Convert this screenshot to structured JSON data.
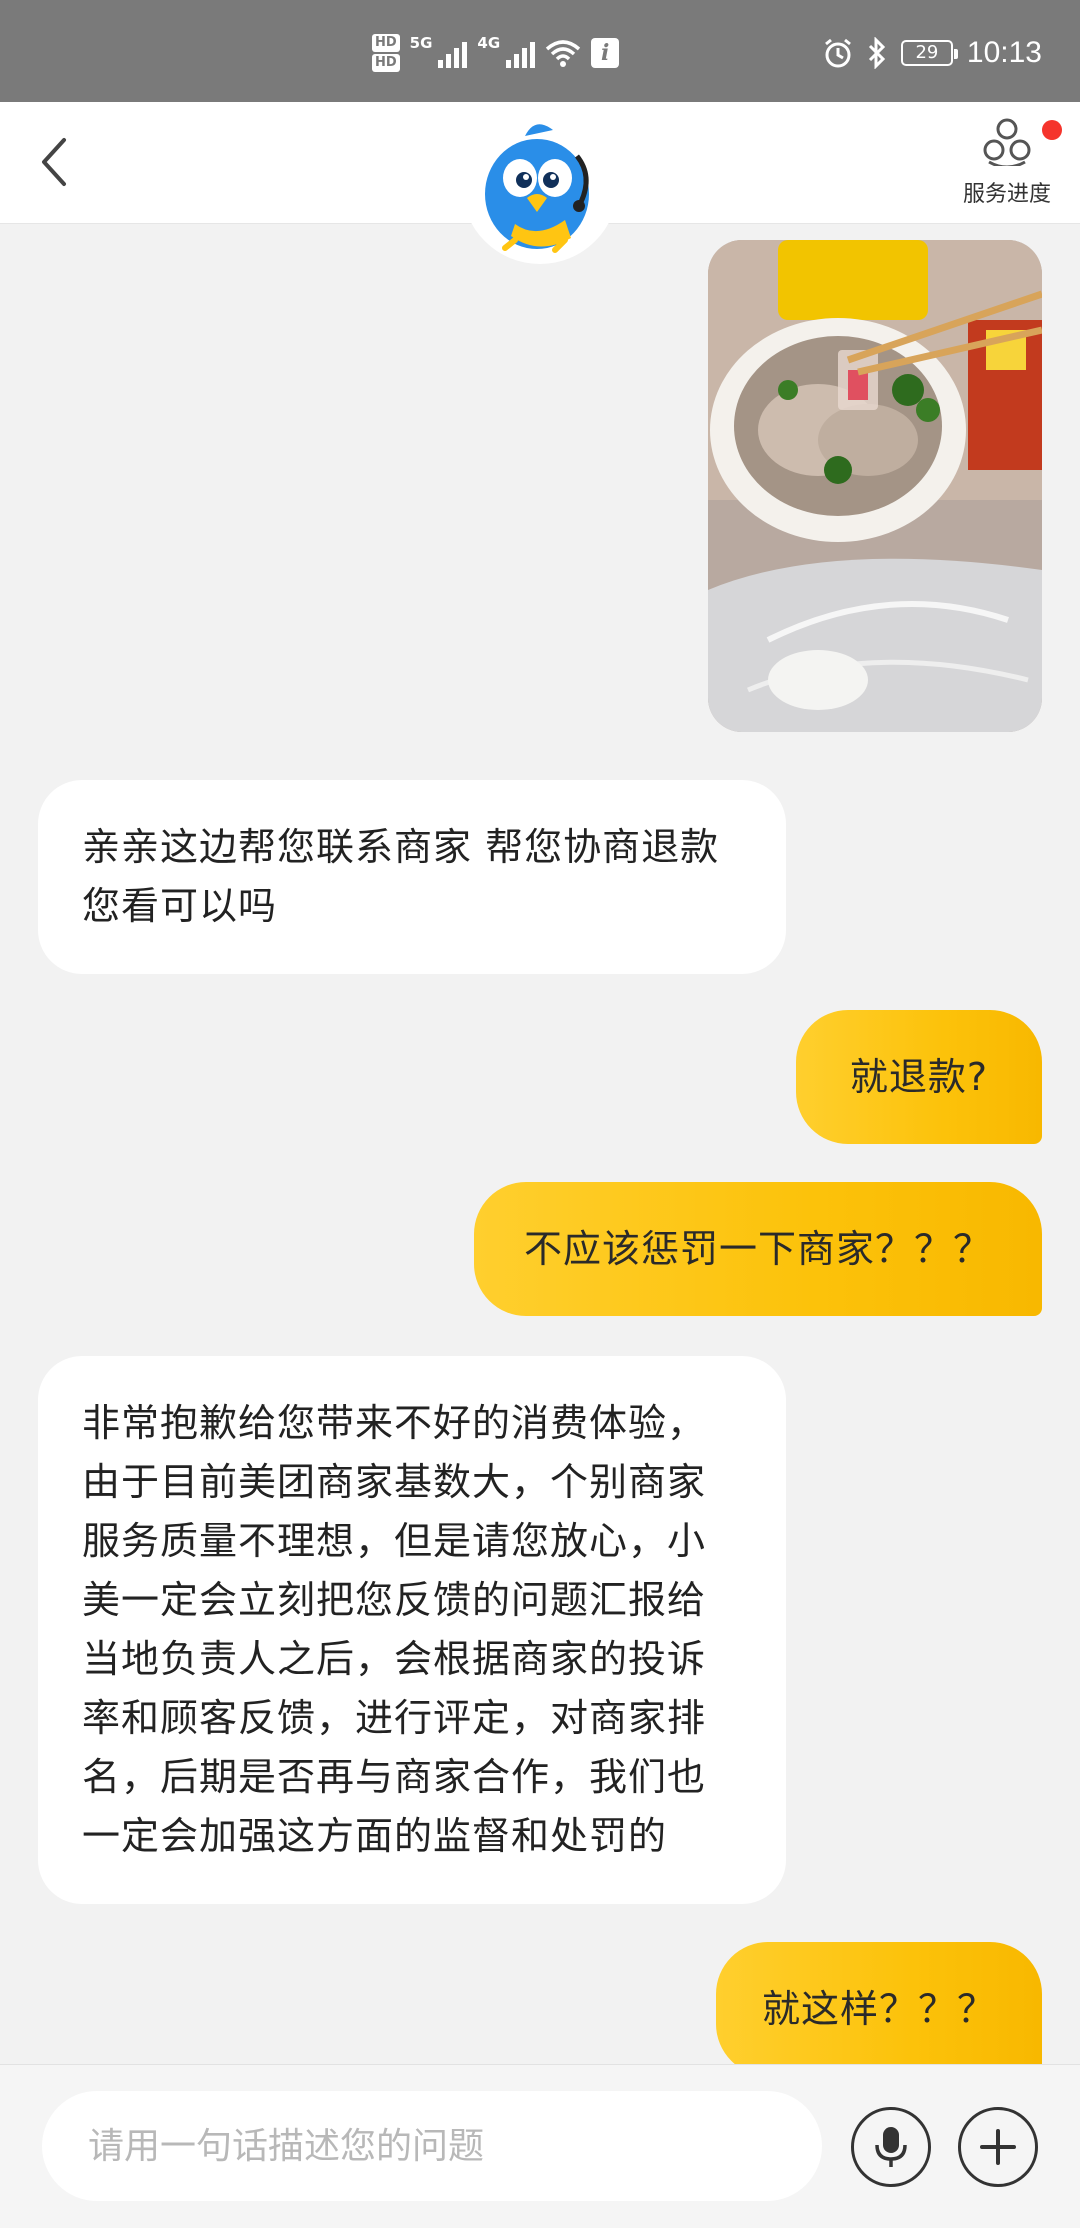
{
  "status_bar": {
    "hd1": "HD",
    "hd2": "HD",
    "net1": "5G",
    "net2": "4G",
    "battery": "29",
    "time": "10:13"
  },
  "header": {
    "service_label": "服务进度"
  },
  "messages": [
    {
      "side": "out",
      "type": "image",
      "icon": "food-photo"
    },
    {
      "side": "in",
      "text": "亲亲这边帮您联系商家  帮您协商退款您看可以吗"
    },
    {
      "side": "out",
      "text": "就退款?"
    },
    {
      "side": "out",
      "text": "不应该惩罚一下商家？？？"
    },
    {
      "side": "in",
      "text": "非常抱歉给您带来不好的消费体验，由于目前美团商家基数大，个别商家服务质量不理想，但是请您放心，小美一定会立刻把您反馈的问题汇报给当地负责人之后，会根据商家的投诉率和顾客反馈，进行评定，对商家排名，后期是否再与商家合作，我们也一定会加强这方面的监督和处罚的"
    },
    {
      "side": "out",
      "text": "就这样？？？"
    }
  ],
  "input": {
    "placeholder": "请用一句话描述您的问题"
  },
  "colors": {
    "accent": "#fcc20a",
    "badge": "#f5342c",
    "status_bar": "#7a7a7a"
  },
  "icons": [
    "back-arrow-icon",
    "service-progress-icon",
    "mascot-avatar-icon",
    "mic-icon",
    "plus-icon"
  ]
}
